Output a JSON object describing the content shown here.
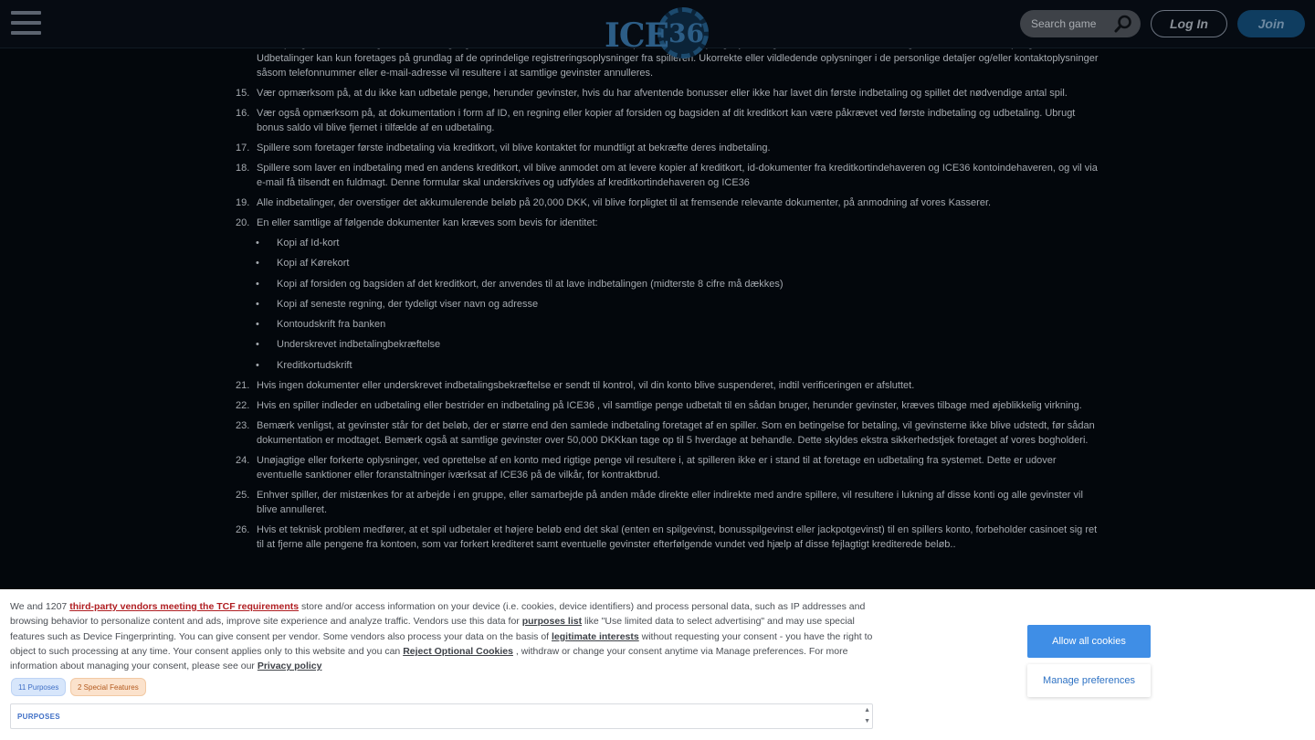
{
  "header": {
    "logo_text": "ICE",
    "logo_number": "36",
    "search_placeholder": "Search game",
    "login_label": "Log In",
    "join_label": "Join"
  },
  "terms": {
    "partial_top": "bonuspenge, vil blive betragtet som misbrug, og vil resultere i at kontoen vil blive suspenderet, bonuspenge fjernes, gevinster annulleres samt muligheden for at udbetale penge bortfalder. Udbetalinger kan kun foretages på grundlag af de oprindelige registreringsoplysninger fra spilleren. Ukorrekte eller vildledende oplysninger i de personlige detaljer og/eller kontaktoplysninger såsom telefonnummer eller e-mail-adresse vil resultere i at samtlige gevinster annulleres.",
    "items": [
      {
        "num": "15.",
        "text": "Vær opmærksom på, at du ikke kan udbetale penge, herunder gevinster, hvis du har afventende bonusser eller ikke har lavet din første indbetaling og spillet det nødvendige antal spil."
      },
      {
        "num": "16.",
        "text": "Vær også opmærksom på, at dokumentation i form af ID, en regning eller kopier af forsiden og bagsiden af dit kreditkort kan være påkrævet ved første indbetaling og udbetaling. Ubrugt bonus saldo vil blive fjernet i tilfælde af en udbetaling."
      },
      {
        "num": "17.",
        "text": "Spillere som foretager første indbetaling via kreditkort, vil blive kontaktet for mundtligt at bekræfte deres indbetaling."
      },
      {
        "num": "18.",
        "text": "Spillere som laver en indbetaling med en andens kreditkort, vil blive anmodet om at levere kopier af kreditkort, id-dokumenter fra kreditkortindehaveren og ICE36 kontoindehaveren, og vil via e-mail få tilsendt en fuldmagt. Denne formular skal underskrives og udfyldes af kreditkortindehaveren og ICE36"
      },
      {
        "num": "19.",
        "text": "Alle indbetalinger, der overstiger det akkumulerende beløb på 20,000 DKK, vil blive forpligtet til at fremsende relevante dokumenter, på anmodning af vores Kasserer."
      },
      {
        "num": "20.",
        "text": "En eller samtlige af følgende dokumenter kan kræves som bevis for identitet:"
      }
    ],
    "docs": [
      "Kopi af Id-kort",
      "Kopi af Kørekort",
      "Kopi af forsiden og bagsiden af det kreditkort, der anvendes til at lave indbetalingen (midterste 8 cifre må dækkes)",
      "Kopi af seneste regning, der tydeligt viser navn og adresse",
      "Kontoudskrift fra banken",
      "Underskrevet indbetalingbekræftelse",
      "Kreditkortudskrift"
    ],
    "items_after": [
      {
        "num": "21.",
        "text": "Hvis ingen dokumenter eller underskrevet indbetalingsbekræftelse er sendt til kontrol, vil din konto blive suspenderet, indtil verificeringen er afsluttet."
      },
      {
        "num": "22.",
        "text": "Hvis en spiller indleder en udbetaling eller bestrider en indbetaling på ICE36 , vil samtlige penge udbetalt til en sådan bruger, herunder gevinster, kræves tilbage med øjeblikkelig virkning."
      },
      {
        "num": "23.",
        "text": "Bemærk venligst, at gevinster står for det beløb, der er større end den samlede indbetaling foretaget af en spiller. Som en betingelse for betaling, vil gevinsterne ikke blive udstedt, før sådan dokumentation er modtaget. Bemærk også at samtlige gevinster over 50,000 DKKkan tage op til 5 hverdage at behandle. Dette skyldes ekstra sikkerhedstjek foretaget af vores bogholderi."
      },
      {
        "num": "24.",
        "text": "Unøjagtige eller forkerte oplysninger, ved oprettelse af en konto med rigtige penge vil resultere i, at spilleren ikke er i stand til at foretage en udbetaling fra systemet. Dette er udover eventuelle sanktioner eller foranstaltninger iværksat af ICE36 på de vilkår, for kontraktbrud."
      },
      {
        "num": "25.",
        "text": "Enhver spiller, der mistænkes for at arbejde i en gruppe, eller samarbejde på anden måde direkte eller indirekte med andre spillere, vil resultere i lukning af disse konti og alle gevinster vil blive annulleret."
      },
      {
        "num": "26.",
        "text": "Hvis et teknisk problem medfører, at et spil udbetaler et højere beløb end det skal (enten en spilgevinst, bonusspilgevinst eller jackpotgevinst) til en spillers konto, forbeholder casinoet sig ret til at fjerne alle pengene fra kontoen, som var forkert krediteret samt eventuelle gevinster efterfølgende vundet ved hjælp af disse fejlagtigt krediterede beløb.."
      }
    ]
  },
  "consent": {
    "t1": "We and 1207 ",
    "link_vendors": "third-party vendors meeting the TCF requirements",
    "t2": " store and/or access information on your device (i.e. cookies, device identifiers) and process personal data, such as IP addresses and browsing behavior to personalize content and ads, improve site experience and analyze traffic. Vendors use this data for ",
    "link_purposes": "purposes list",
    "t3": "  like \"Use limited data to select advertising\" and may use special features such as Device Fingerprinting. You can give consent per vendor. Some vendors also process your data on the basis of ",
    "link_legit": "legitimate interests",
    "t4": "  without requesting your consent - you have the right to object to such processing at any time. Your consent applies only to this website and you can ",
    "link_reject": "Reject Optional Cookies",
    "t5": " , withdraw or change your consent anytime via Manage preferences. For more information about managing your consent, please see our ",
    "link_privacy": "Privacy policy",
    "tag_purposes": "11 Purposes",
    "tag_special": "2 Special Features",
    "purposes_label": "PURPOSES",
    "allow_label": "Allow all cookies",
    "manage_label": "Manage preferences"
  }
}
